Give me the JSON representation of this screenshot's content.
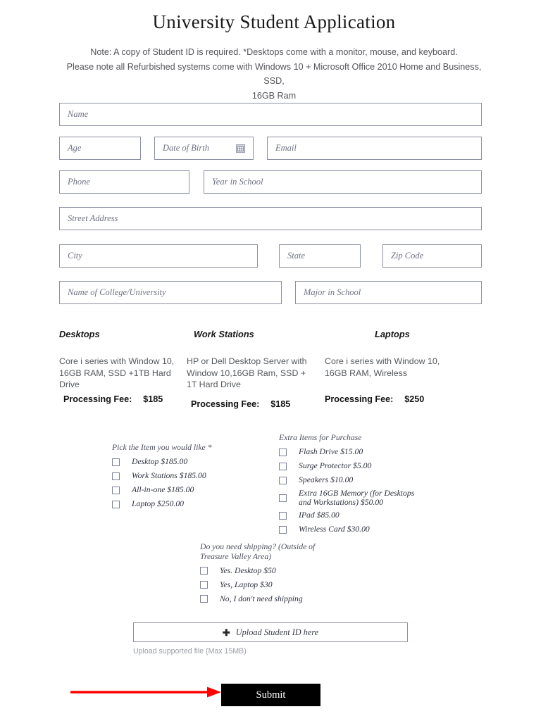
{
  "header": {
    "title": "University Student Application",
    "note_lines": [
      "Note: A copy of Student ID is required. *Desktops come with a monitor, mouse, and keyboard.",
      "Please note all Refurbished systems come with Windows 10 + Microsoft Office 2010 Home and Business, SSD,",
      "16GB Ram"
    ]
  },
  "fields": {
    "name": "Name",
    "age": "Age",
    "dob": "Date of Birth",
    "dob_icon": "calendar-icon",
    "email": "Email",
    "phone": "Phone",
    "year_in_school": "Year in School",
    "street_address": "Street Address",
    "city": "City",
    "state": "State",
    "zip": "Zip Code",
    "college": "Name of College/University",
    "major": "Major in School"
  },
  "products": [
    {
      "heading": "Desktops",
      "description": "Core i series with Window 10,  16GB RAM,  SSD +1TB Hard Drive",
      "fee_label": "Processing Fee:",
      "fee_amount": "$185"
    },
    {
      "heading": "Work Stations",
      "description": "HP or Dell Desktop Server with Window 10,16GB Ram, SSD + 1T Hard Drive",
      "fee_label": "Processing Fee:",
      "fee_amount": "$185"
    },
    {
      "heading": "Laptops",
      "description": "Core i series with Window 10, 16GB RAM, Wireless",
      "fee_label": "Processing Fee:",
      "fee_amount": "$250"
    }
  ],
  "pick_item_group": {
    "title": "Pick the Item you would like *",
    "options": [
      "Desktop $185.00",
      "Work Stations $185.00",
      "All-in-one $185.00",
      "Laptop $250.00"
    ]
  },
  "extra_items_group": {
    "title": "Extra Items for Purchase",
    "options": [
      "Flash Drive $15.00",
      "Surge Protector $5.00",
      "Speakers $10.00",
      "Extra 16GB Memory (for Desktops and Workstations) $50.00",
      "IPad $85.00",
      "Wireless Card $30.00"
    ]
  },
  "shipping_group": {
    "title": "Do you need shipping? (Outside of Treasure Valley Area)",
    "options": [
      "Yes. Desktop $50",
      "Yes, Laptop $30",
      "No, I don't need shipping"
    ]
  },
  "upload": {
    "plus_icon": "plus-icon",
    "label": "Upload Student ID here",
    "hint": "Upload supported file (Max 15MB)"
  },
  "submit": {
    "label": "Submit"
  },
  "annotation": {
    "arrow_icon": "red-arrow-icon",
    "arrow_color": "#ff0000"
  },
  "colors": {
    "field_border": "#8b8fa3",
    "submit_bg": "#000000",
    "page_bg": "#ffffff"
  }
}
